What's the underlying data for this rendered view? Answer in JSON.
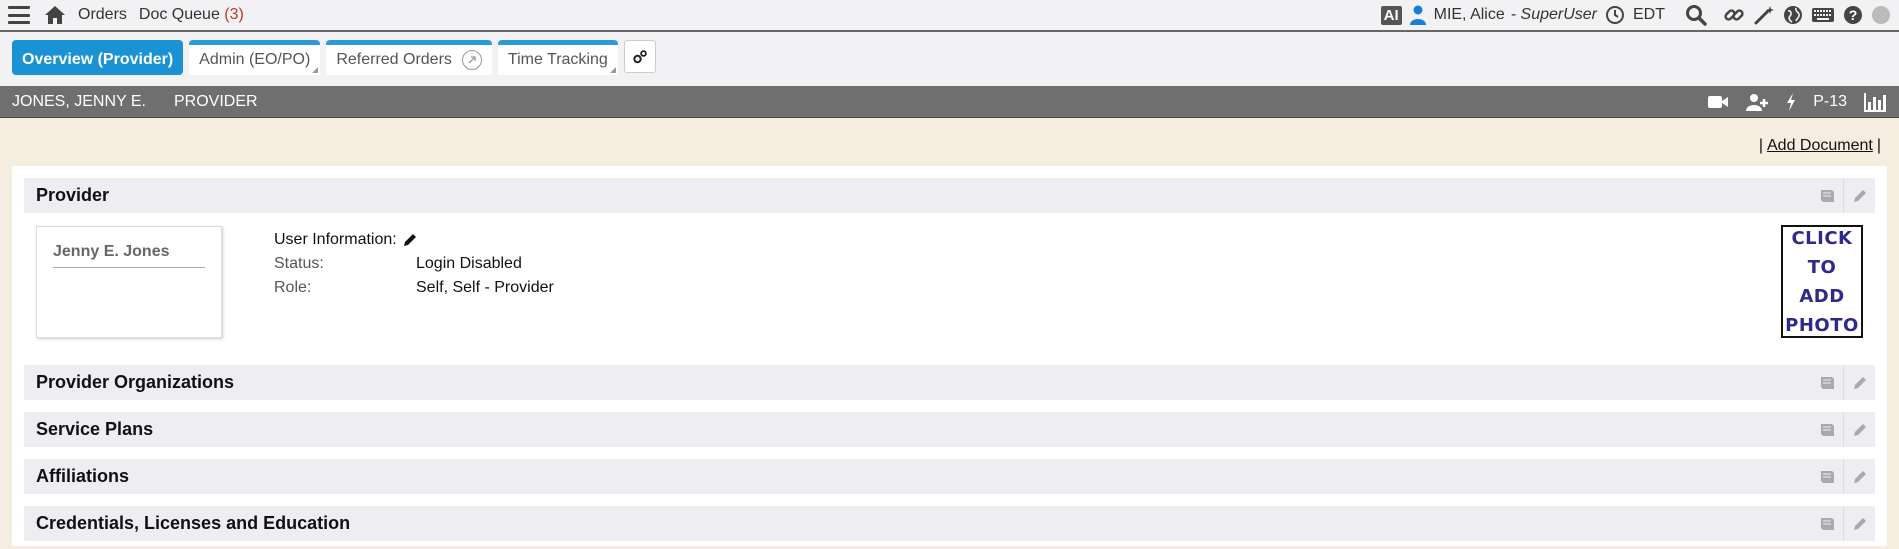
{
  "topbar": {
    "orders": "Orders",
    "doc_queue": "Doc Queue",
    "doc_queue_count": "(3)",
    "ai_badge": "AI",
    "user": "MIE, Alice",
    "role": "- SuperUser",
    "timezone": "EDT",
    "icons": [
      "menu-icon",
      "home-icon",
      "user-icon",
      "clock-icon",
      "search-icon",
      "link-icon",
      "wand-icon",
      "globe-icon",
      "keyboard-icon",
      "help-icon",
      "status-dot-icon"
    ]
  },
  "tabs": [
    {
      "label": "Overview (Provider)",
      "active": true
    },
    {
      "label": "Admin (EO/PO)"
    },
    {
      "label": "Referred Orders"
    },
    {
      "label": "Time Tracking"
    }
  ],
  "patientbar": {
    "name": "JONES, JENNY E.",
    "type": "PROVIDER",
    "page": "P-13",
    "icons": [
      "video-icon",
      "add-user-icon",
      "bolt-icon",
      "chart-icon"
    ]
  },
  "actions": {
    "sep_left": "|",
    "add_document": "Add Document",
    "sep_right": "|"
  },
  "provider": {
    "title": "Provider",
    "card_name": "Jenny E. Jones",
    "info_title": "User Information:",
    "status_label": "Status:",
    "status_value": "Login Disabled",
    "role_label": "Role:",
    "role_value": "Self, Self - Provider",
    "photo_line1": "CLICK",
    "photo_line2": "TO ADD",
    "photo_line3": "PHOTO"
  },
  "sections": [
    {
      "title": "Provider Organizations"
    },
    {
      "title": "Service Plans"
    },
    {
      "title": "Affiliations"
    },
    {
      "title": "Credentials, Licenses and Education"
    }
  ],
  "colors": {
    "accent": "#1a92d4",
    "patientbar": "#6f6f6f",
    "page_bg": "#f5ede0",
    "photo_text": "#2e2a8c",
    "count_red": "#c0392b"
  }
}
